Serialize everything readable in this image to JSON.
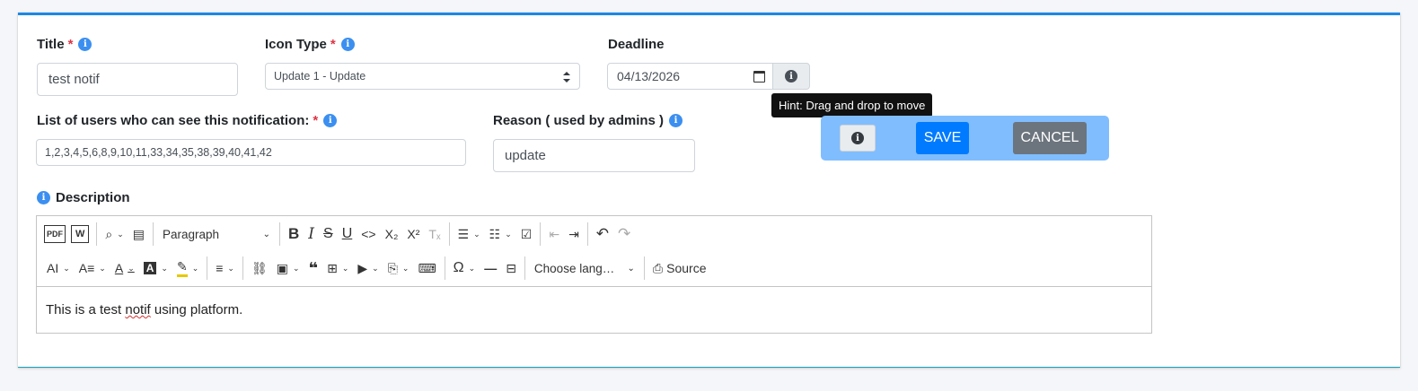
{
  "form": {
    "title_label": "Title",
    "title_value": "test notif",
    "icon_type_label": "Icon Type",
    "icon_type_value": "Update 1 - Update",
    "deadline_label": "Deadline",
    "deadline_value": "04/13/2026",
    "users_label": "List of users who can see this notification:",
    "users_value": "1,2,3,4,5,6,8,9,10,11,33,34,35,38,39,40,41,42",
    "reason_label": "Reason ( used by admins )",
    "reason_value": "update",
    "description_label": "Description",
    "required_marker": "*"
  },
  "tooltip": {
    "text": "Hint: Drag and drop to move"
  },
  "floating_bar": {
    "save_label": "SAVE",
    "cancel_label": "CANCEL"
  },
  "editor": {
    "toolbar_row1": [
      {
        "name": "export-pdf-button",
        "glyph": "PDF"
      },
      {
        "name": "export-word-button",
        "glyph": "W"
      },
      {
        "name": "find-replace-button",
        "glyph": "⌕",
        "dropdown": true
      },
      {
        "name": "select-all-button",
        "glyph": "▤"
      },
      {
        "name": "heading-dropdown",
        "label": "Paragraph"
      },
      {
        "name": "bold-button",
        "glyph": "B"
      },
      {
        "name": "italic-button",
        "glyph": "I"
      },
      {
        "name": "strikethrough-button",
        "glyph": "S"
      },
      {
        "name": "underline-button",
        "glyph": "U"
      },
      {
        "name": "code-button",
        "glyph": "<>"
      },
      {
        "name": "subscript-button",
        "glyph": "X₂"
      },
      {
        "name": "superscript-button",
        "glyph": "X²"
      },
      {
        "name": "remove-format-button",
        "glyph": "Tₓ"
      },
      {
        "name": "bulleted-list-button",
        "glyph": "☰"
      },
      {
        "name": "numbered-list-button",
        "glyph": "☷"
      },
      {
        "name": "todo-list-button",
        "glyph": "☑"
      },
      {
        "name": "outdent-button",
        "glyph": "⇤"
      },
      {
        "name": "indent-button",
        "glyph": "⇥"
      },
      {
        "name": "undo-button",
        "glyph": "↶"
      },
      {
        "name": "redo-button",
        "glyph": "↷"
      }
    ],
    "heading_value": "Paragraph",
    "language_value": "Choose lang…",
    "source_label": "Source",
    "content_before": "This is a test ",
    "content_misspelled": "notif",
    "content_after": " using platform."
  },
  "colors": {
    "accent": "#1e88e5",
    "save_button": "#007bff",
    "cancel_button": "#6c757d",
    "floating_bar": "#80bdff",
    "required": "#dc3545",
    "info_icon": "#3b8ff0"
  }
}
